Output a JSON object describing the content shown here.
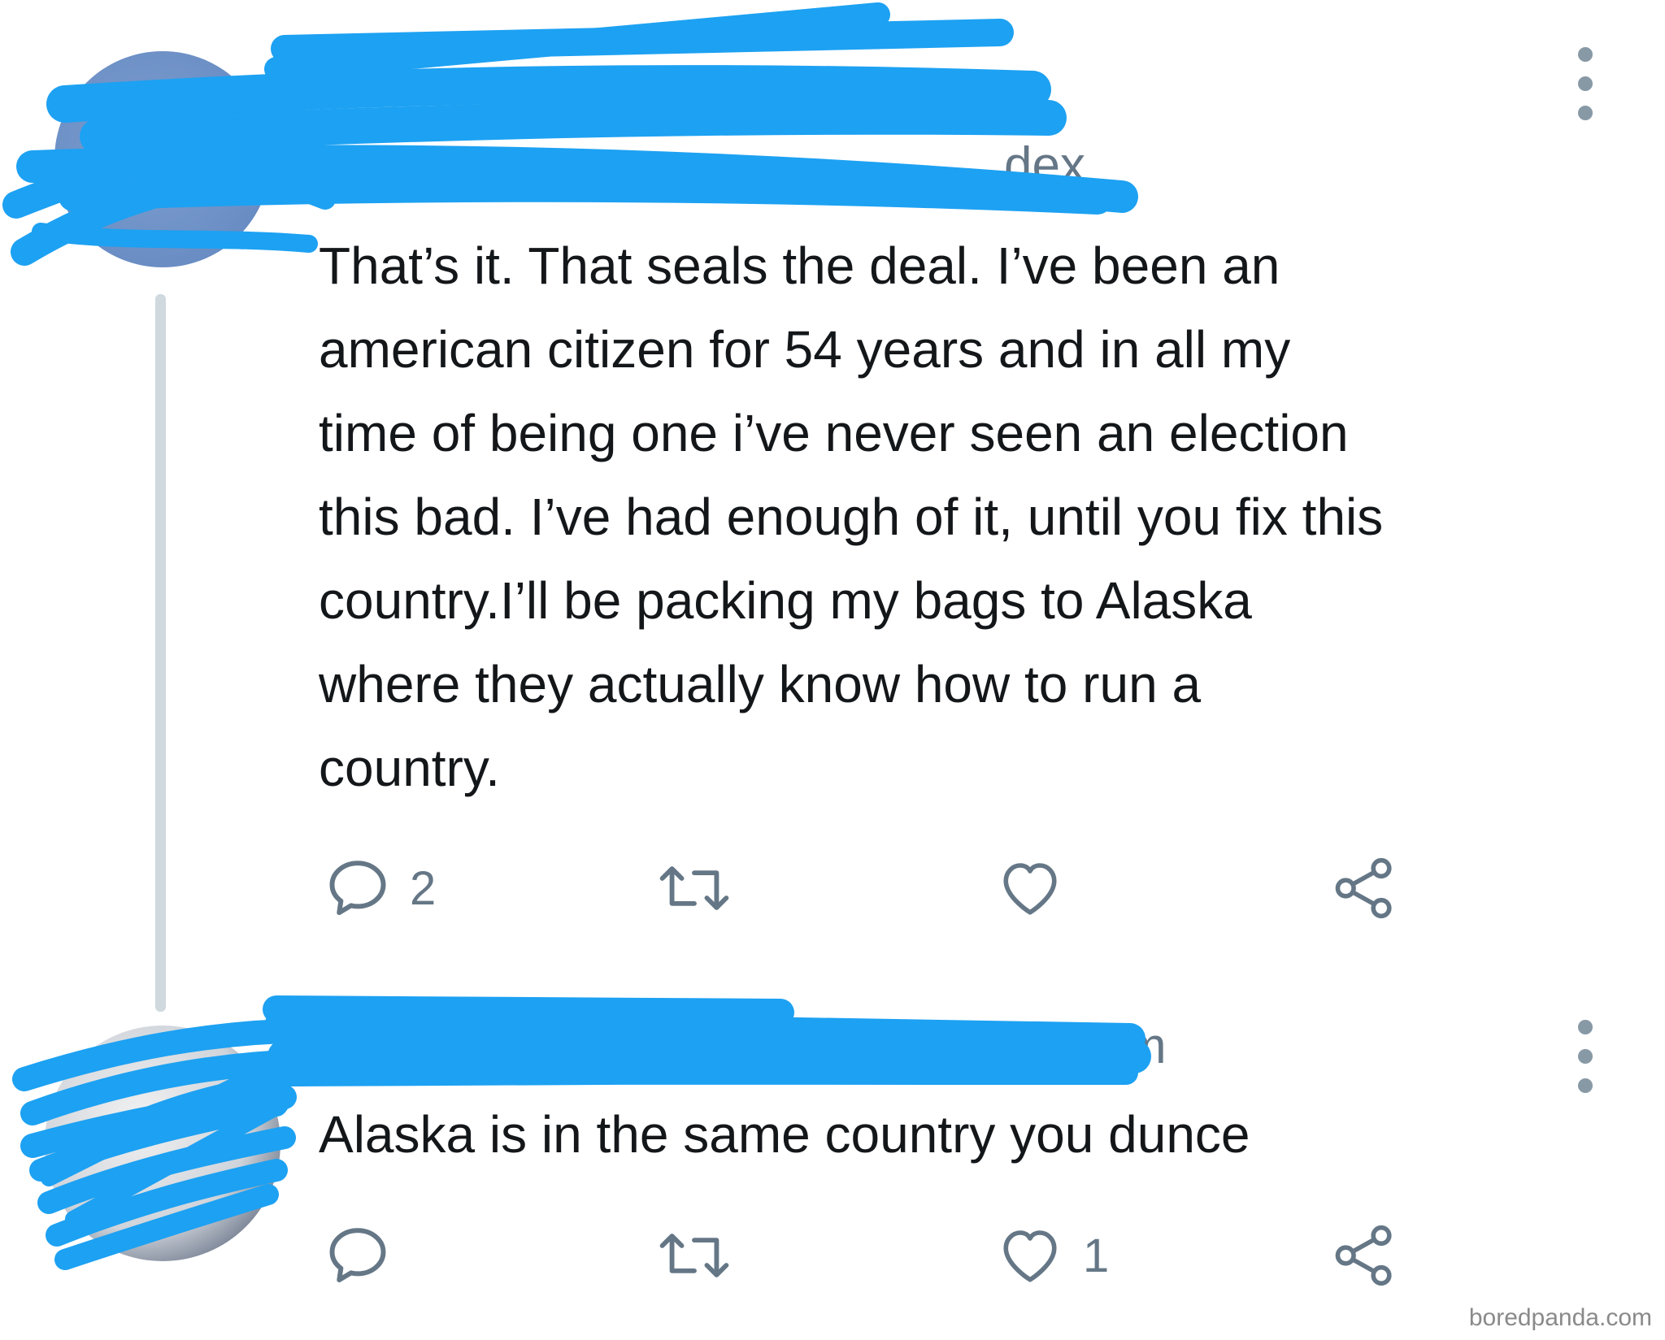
{
  "tweets": [
    {
      "header_visible_fragment": "dex",
      "text_lines": [
        "That’s it. That seals the deal. I’ve been an",
        "american citizen for 54 years and in all my",
        "time of being one i’ve never seen an election",
        "this bad. I’ve had enough of it, until you fix this",
        "country.I’ll be packing my bags to Alaska",
        "where they actually know how to run a",
        "country."
      ],
      "actions": {
        "reply_count": "2",
        "retweet_count": "",
        "like_count": "",
        "reply_icon": "reply-icon",
        "retweet_icon": "retweet-icon",
        "like_icon": "heart-icon",
        "share_icon": "share-icon"
      }
    },
    {
      "header_visible_fragment": "m",
      "text": "Alaska is in the same country you dunce",
      "actions": {
        "reply_count": "",
        "retweet_count": "",
        "like_count": "1",
        "reply_icon": "reply-icon",
        "retweet_icon": "retweet-icon",
        "like_icon": "heart-icon",
        "share_icon": "share-icon"
      }
    }
  ],
  "watermark": "boredpanda.com",
  "colors": {
    "text": "#14171a",
    "secondary": "#657786",
    "redaction": "#1da1f2",
    "thread_line": "#cfd9de"
  }
}
